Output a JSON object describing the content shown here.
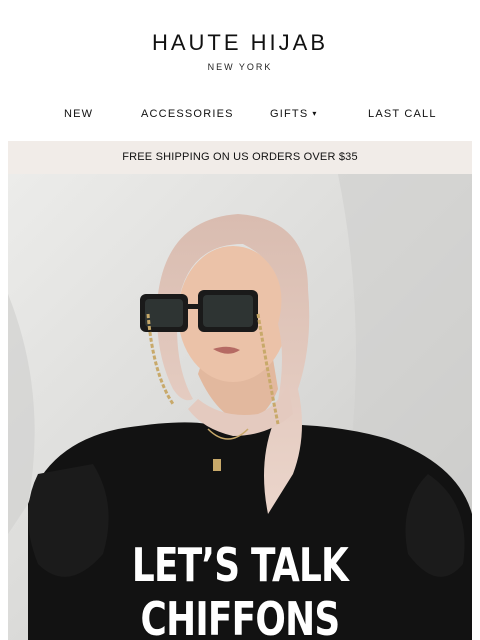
{
  "brand": {
    "name": "HAUTE HIJAB",
    "location": "NEW YORK"
  },
  "nav": {
    "items": [
      {
        "label": "NEW"
      },
      {
        "label": "ACCESSORIES"
      },
      {
        "label": "GIFTS",
        "icon": "chevron-down-icon"
      },
      {
        "label": "LAST CALL"
      }
    ]
  },
  "promo": {
    "text": "FREE SHIPPING ON US ORDERS OVER $35"
  },
  "hero": {
    "title": "LET’S TALK CHIFFONS"
  },
  "colors": {
    "promo_bg": "#f1ece8",
    "hijab": "#e3c9bd",
    "outfit": "#121212"
  }
}
